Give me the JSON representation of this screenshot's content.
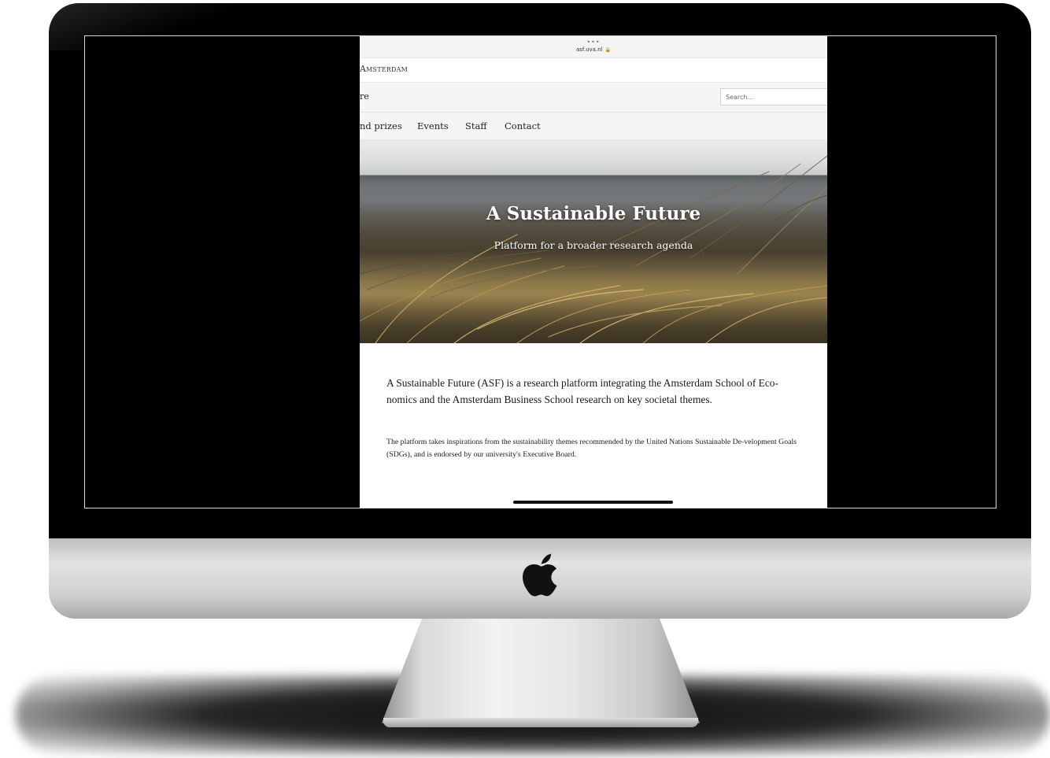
{
  "browser": {
    "dots": "•••",
    "url": "asf.uva.nl",
    "lock_icon": "lock-icon"
  },
  "header": {
    "university_name": "Amsterdam",
    "site_name": "re",
    "search_placeholder": "Search..."
  },
  "nav": {
    "items": [
      {
        "label": "nd prizes"
      },
      {
        "label": "Events"
      },
      {
        "label": "Staff"
      },
      {
        "label": "Contact"
      }
    ]
  },
  "hero": {
    "title": "A Sustainable Future",
    "subtitle": "Platform for a broader research agenda"
  },
  "content": {
    "intro": "A Sustainable Future (ASF) is a research platform integrating the Amsterdam School of Eco-nomics and the Amsterdam Business School research on key societal themes.",
    "body": "The platform takes inspirations from the sustainability themes recommended by the United Nations Sustainable De-velopment Goals (SDGs), and is endorsed by our university's Executive Board."
  },
  "colors": {
    "bezel": "#000000",
    "page_background": "#ffffff",
    "nav_background": "#f5f5f5",
    "text": "#1a1a1a",
    "hero_text": "#ffffff"
  }
}
